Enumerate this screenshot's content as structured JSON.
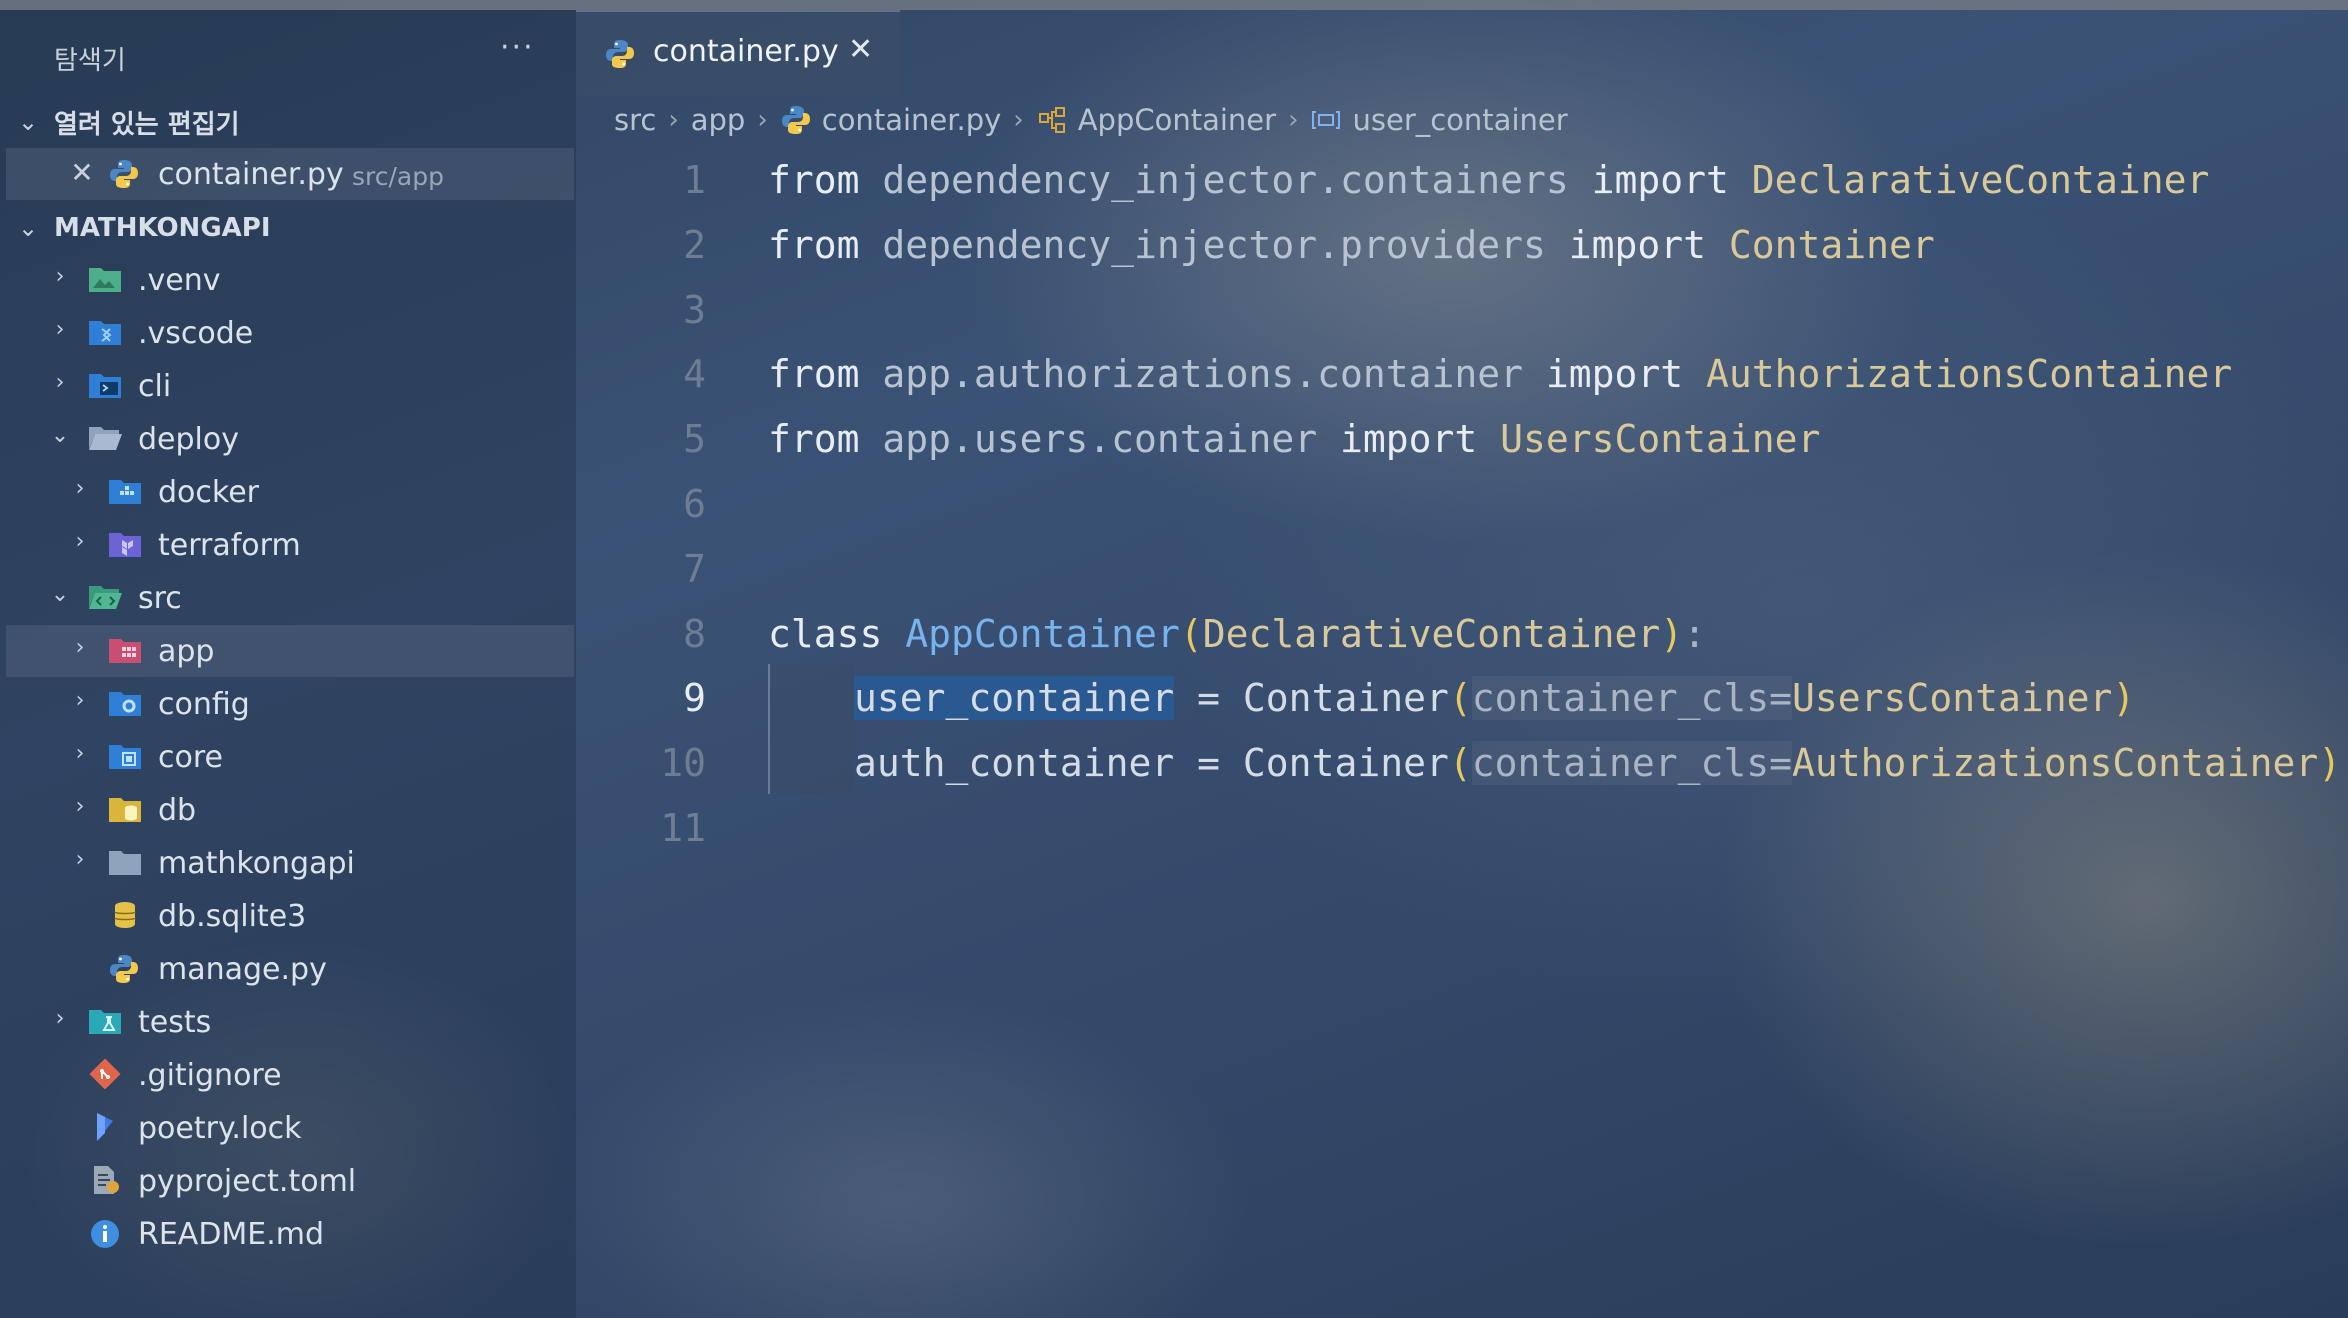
{
  "explorer": {
    "title": "탐색기",
    "more": "···",
    "open_editors_label": "열려 있는 편집기",
    "open_editors": [
      {
        "name": "container.py",
        "path": "src/app",
        "close": "✕"
      }
    ],
    "project_label": "MATHKONGAPI",
    "tree": [
      {
        "label": ".venv",
        "chevron": "›",
        "icon": "venv-folder-icon"
      },
      {
        "label": ".vscode",
        "chevron": "›",
        "icon": "vscode-folder-icon"
      },
      {
        "label": "cli",
        "chevron": "›",
        "icon": "cli-folder-icon"
      },
      {
        "label": "deploy",
        "chevron": "⌄",
        "icon": "folder-open-icon"
      },
      {
        "label": "docker",
        "chevron": "›",
        "icon": "docker-folder-icon"
      },
      {
        "label": "terraform",
        "chevron": "›",
        "icon": "terraform-folder-icon"
      },
      {
        "label": "src",
        "chevron": "⌄",
        "icon": "src-folder-icon"
      },
      {
        "label": "app",
        "chevron": "›",
        "icon": "app-folder-icon"
      },
      {
        "label": "config",
        "chevron": "›",
        "icon": "config-folder-icon"
      },
      {
        "label": "core",
        "chevron": "›",
        "icon": "core-folder-icon"
      },
      {
        "label": "db",
        "chevron": "›",
        "icon": "db-folder-icon"
      },
      {
        "label": "mathkongapi",
        "chevron": "›",
        "icon": "folder-icon"
      },
      {
        "label": "db.sqlite3",
        "chevron": "",
        "icon": "database-icon"
      },
      {
        "label": "manage.py",
        "chevron": "",
        "icon": "python-icon"
      },
      {
        "label": "tests",
        "chevron": "›",
        "icon": "tests-folder-icon"
      },
      {
        "label": ".gitignore",
        "chevron": "",
        "icon": "git-icon"
      },
      {
        "label": "poetry.lock",
        "chevron": "",
        "icon": "poetry-icon"
      },
      {
        "label": "pyproject.toml",
        "chevron": "",
        "icon": "toml-icon"
      },
      {
        "label": "README.md",
        "chevron": "",
        "icon": "info-icon"
      }
    ]
  },
  "tab": {
    "label": "container.py",
    "close": "✕"
  },
  "breadcrumb": [
    "src",
    "app",
    "container.py",
    "AppContainer",
    "user_container"
  ],
  "editor": {
    "active_line": 9,
    "line_numbers": [
      "1",
      "2",
      "3",
      "4",
      "5",
      "6",
      "7",
      "8",
      "9",
      "10",
      "11"
    ],
    "lines": {
      "l1": [
        "from",
        " dependency_injector.containers ",
        "import",
        " DeclarativeContainer"
      ],
      "l2": [
        "from",
        " dependency_injector.providers ",
        "import",
        " Container"
      ],
      "l4": [
        "from",
        " app.authorizations.container ",
        "import",
        " AuthorizationsContainer"
      ],
      "l5": [
        "from",
        " app.users.container ",
        "import",
        " UsersContainer"
      ],
      "l8": [
        "class",
        " ",
        "AppContainer",
        "(",
        "DeclarativeContainer",
        ")",
        ":"
      ],
      "l9": [
        "user_container",
        " = Container",
        "(",
        "container_cls",
        "=",
        "UsersContainer",
        ")"
      ],
      "l10": [
        "auth_container",
        " = Container",
        "(",
        "container_cls",
        "=",
        "AuthorizationsContainer",
        ")"
      ]
    }
  },
  "colors": {
    "keyword": "#e8edf3",
    "class_name": "#78b3ee",
    "type": "#d9c99a",
    "paren": "#e7c85e",
    "selection": "#285a96"
  }
}
